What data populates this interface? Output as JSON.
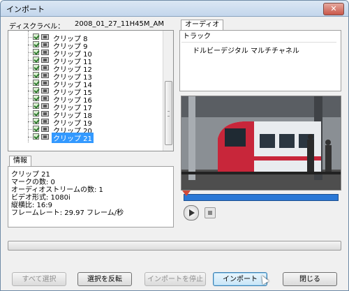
{
  "window": {
    "title": "インポート",
    "close_label": "✕"
  },
  "disc": {
    "label": "ディスクラベル：",
    "value": "2008_01_27_11H45M_AM"
  },
  "clips": [
    {
      "label": "クリップ 8"
    },
    {
      "label": "クリップ 9"
    },
    {
      "label": "クリップ 10"
    },
    {
      "label": "クリップ 11"
    },
    {
      "label": "クリップ 12"
    },
    {
      "label": "クリップ 13"
    },
    {
      "label": "クリップ 14"
    },
    {
      "label": "クリップ 15"
    },
    {
      "label": "クリップ 16"
    },
    {
      "label": "クリップ 17"
    },
    {
      "label": "クリップ 18"
    },
    {
      "label": "クリップ 19"
    },
    {
      "label": "クリップ 20"
    },
    {
      "label": "クリップ 21",
      "selected": true
    }
  ],
  "audio": {
    "tab": "オーディオ",
    "column": "トラック",
    "tracks": [
      "ドルビーデジタル マルチチャネル"
    ]
  },
  "info": {
    "tab": "情報",
    "lines": [
      "クリップ 21",
      "マークの数: 0",
      "オーディオストリームの数: 1",
      "ビデオ形式: 1080i",
      "縦横比: 16:9",
      "フレームレート: 29.97 フレーム/秒"
    ]
  },
  "buttons": {
    "select_all": "すべて選択",
    "invert": "選択を反転",
    "stop_import": "インポートを停止",
    "import": "インポート",
    "close": "閉じる"
  }
}
